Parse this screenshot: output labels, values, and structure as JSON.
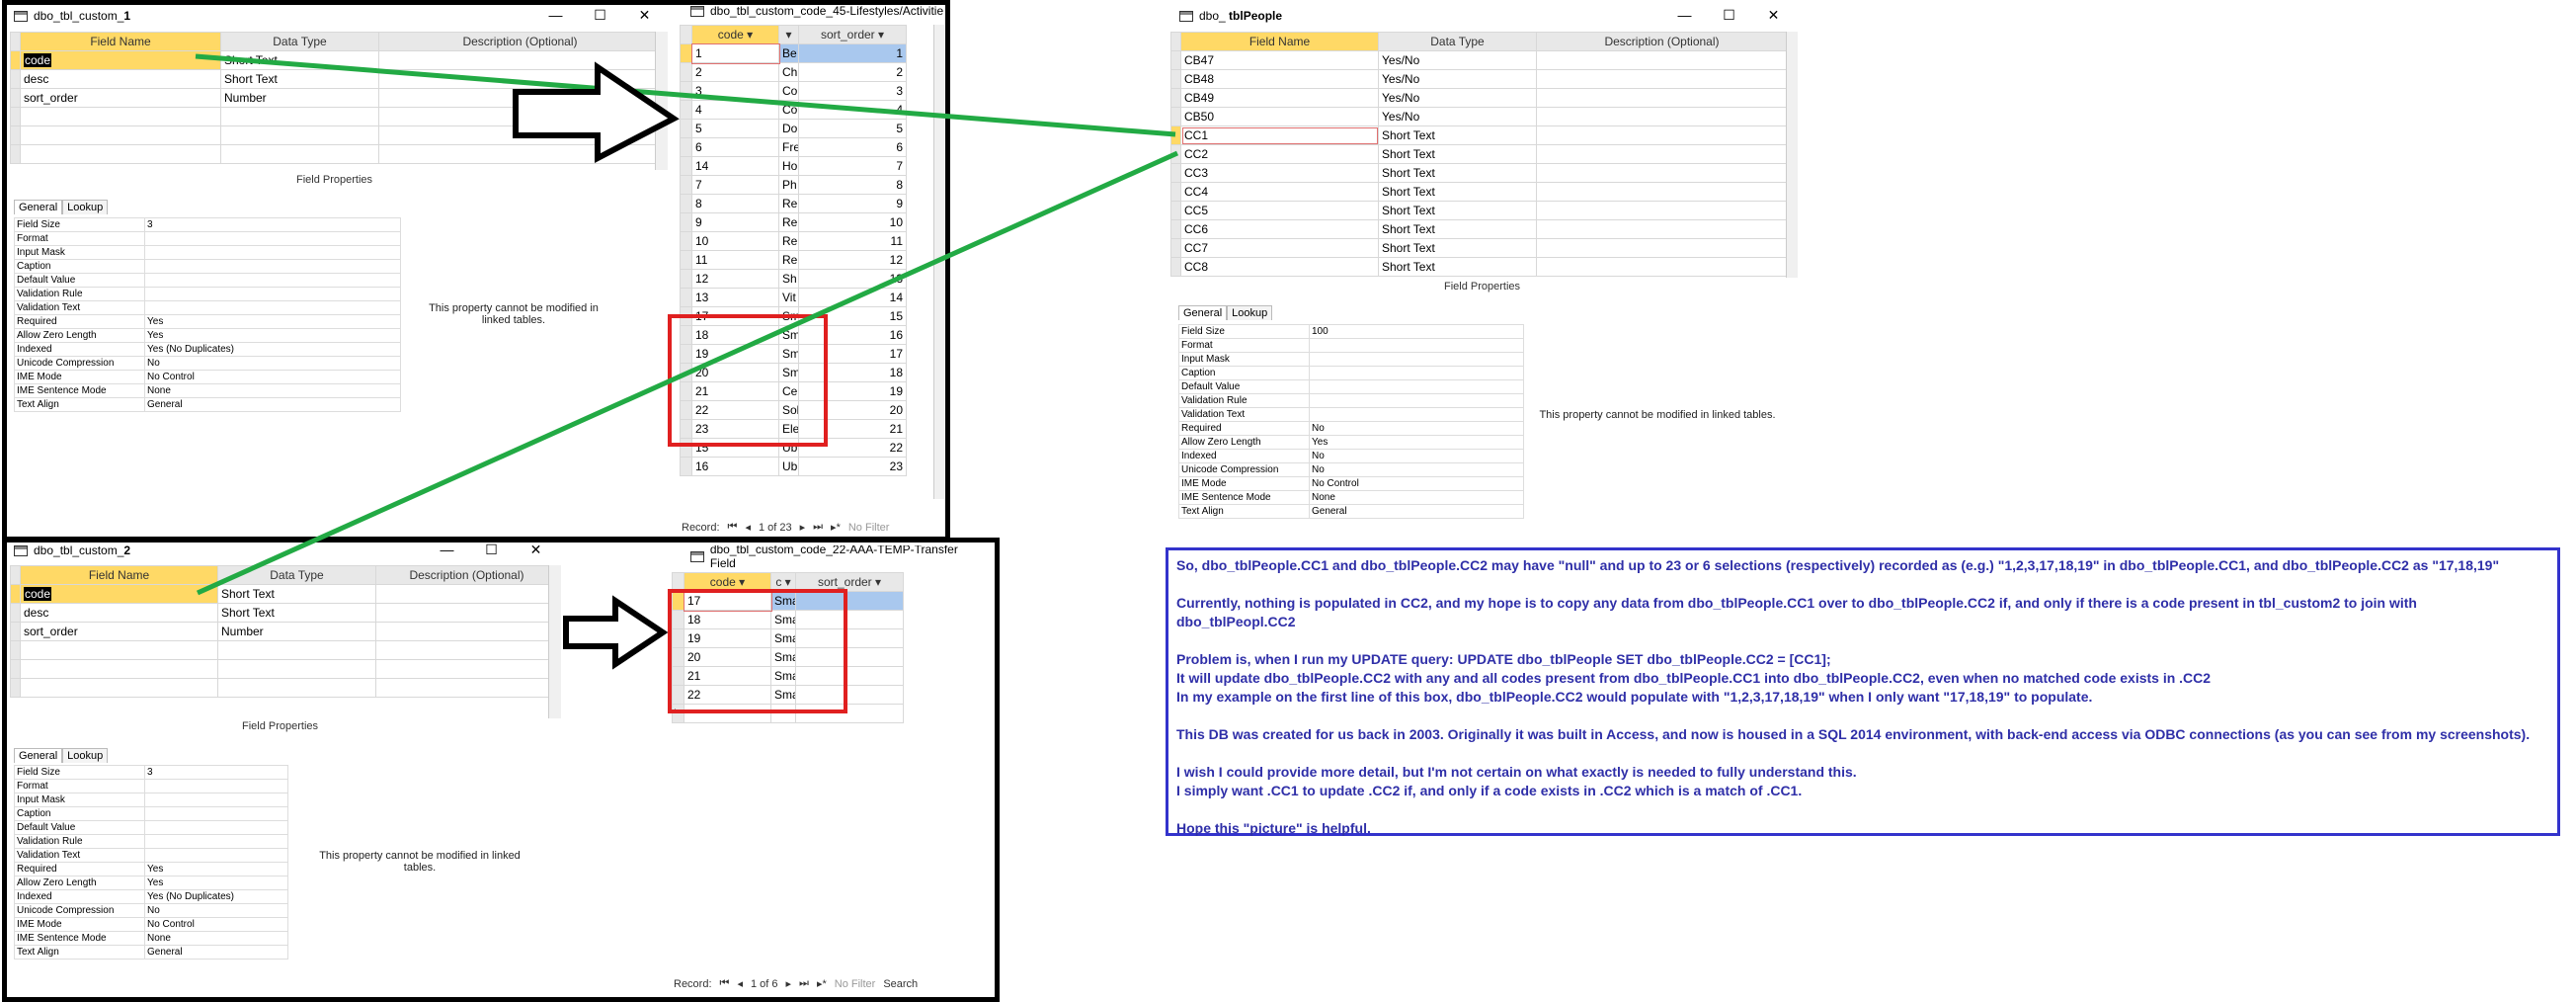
{
  "win1": {
    "title_pre": "dbo_tbl_custom_",
    "title_num": "1",
    "headers": [
      "Field Name",
      "Data Type",
      "Description (Optional)"
    ],
    "rows": [
      {
        "name": "code",
        "type": "Short Text"
      },
      {
        "name": "desc",
        "type": "Short Text"
      },
      {
        "name": "sort_order",
        "type": "Number"
      }
    ],
    "field_properties": "Field Properties",
    "tabs": [
      "General",
      "Lookup"
    ],
    "props": [
      [
        "Field Size",
        "3"
      ],
      [
        "Format",
        ""
      ],
      [
        "Input Mask",
        ""
      ],
      [
        "Caption",
        ""
      ],
      [
        "Default Value",
        ""
      ],
      [
        "Validation Rule",
        ""
      ],
      [
        "Validation Text",
        ""
      ],
      [
        "Required",
        "Yes"
      ],
      [
        "Allow Zero Length",
        "Yes"
      ],
      [
        "Indexed",
        "Yes (No Duplicates)"
      ],
      [
        "Unicode Compression",
        "No"
      ],
      [
        "IME Mode",
        "No Control"
      ],
      [
        "IME Sentence Mode",
        "None"
      ],
      [
        "Text Align",
        "General"
      ]
    ],
    "note": "This property cannot be modified in linked tables."
  },
  "win2": {
    "title_pre": "dbo_tbl_custom_",
    "title_num": "2",
    "headers": [
      "Field Name",
      "Data Type",
      "Description (Optional)"
    ],
    "rows": [
      {
        "name": "code",
        "type": "Short Text"
      },
      {
        "name": "desc",
        "type": "Short Text"
      },
      {
        "name": "sort_order",
        "type": "Number"
      }
    ],
    "field_properties": "Field Properties",
    "tabs": [
      "General",
      "Lookup"
    ],
    "props": [
      [
        "Field Size",
        "3"
      ],
      [
        "Format",
        ""
      ],
      [
        "Input Mask",
        ""
      ],
      [
        "Caption",
        ""
      ],
      [
        "Default Value",
        ""
      ],
      [
        "Validation Rule",
        ""
      ],
      [
        "Validation Text",
        ""
      ],
      [
        "Required",
        "Yes"
      ],
      [
        "Allow Zero Length",
        "Yes"
      ],
      [
        "Indexed",
        "Yes (No Duplicates)"
      ],
      [
        "Unicode Compression",
        "No"
      ],
      [
        "IME Mode",
        "No Control"
      ],
      [
        "IME Sentence Mode",
        "None"
      ],
      [
        "Text Align",
        "General"
      ]
    ],
    "note": "This property cannot be modified in linked tables."
  },
  "ds1": {
    "title": "dbo_tbl_custom_code_45-Lifestyles/Activitie",
    "headers": [
      "code",
      "",
      "sort_order"
    ],
    "rows": [
      [
        "1",
        "Be",
        "1"
      ],
      [
        "2",
        "Ch",
        "2"
      ],
      [
        "3",
        "Co",
        "3"
      ],
      [
        "4",
        "Co",
        "4"
      ],
      [
        "5",
        "Do",
        "5"
      ],
      [
        "6",
        "Fre",
        "6"
      ],
      [
        "14",
        "Ho",
        "7"
      ],
      [
        "7",
        "Ph",
        "8"
      ],
      [
        "8",
        "Re",
        "9"
      ],
      [
        "9",
        "Re",
        "10"
      ],
      [
        "10",
        "Re",
        "11"
      ],
      [
        "11",
        "Re",
        "12"
      ],
      [
        "12",
        "Sh",
        "13"
      ],
      [
        "13",
        "Vit",
        "14"
      ],
      [
        "17",
        "Sm",
        "15"
      ],
      [
        "18",
        "Sm",
        "16"
      ],
      [
        "19",
        "Sm",
        "17"
      ],
      [
        "20",
        "Sm",
        "18"
      ],
      [
        "21",
        "Ce",
        "19"
      ],
      [
        "22",
        "Sol",
        "20"
      ],
      [
        "23",
        "Ele",
        "21"
      ],
      [
        "15",
        "Ub",
        "22"
      ],
      [
        "16",
        "Ub",
        "23"
      ]
    ],
    "record_label": "Record:",
    "record_pos": "1 of 23",
    "no_filter": "No Filter"
  },
  "ds2": {
    "title": "dbo_tbl_custom_code_22-AAA-TEMP-Transfer Field",
    "headers": [
      "code",
      "c",
      "sort_order"
    ],
    "rows": [
      [
        "17",
        "Sma",
        ""
      ],
      [
        "18",
        "Sma",
        ""
      ],
      [
        "19",
        "Sma",
        ""
      ],
      [
        "20",
        "Sma",
        ""
      ],
      [
        "21",
        "Sma",
        ""
      ],
      [
        "22",
        "Sma",
        ""
      ]
    ],
    "record_label": "Record:",
    "record_pos": "1 of 6",
    "no_filter": "No Filter",
    "search": "Search"
  },
  "people": {
    "title_pre": "dbo_",
    "title_main": "tblPeople",
    "headers": [
      "Field Name",
      "Data Type",
      "Description (Optional)"
    ],
    "rows": [
      {
        "name": "CB47",
        "type": "Yes/No"
      },
      {
        "name": "CB48",
        "type": "Yes/No"
      },
      {
        "name": "CB49",
        "type": "Yes/No"
      },
      {
        "name": "CB50",
        "type": "Yes/No"
      },
      {
        "name": "CC1",
        "type": "Short Text"
      },
      {
        "name": "CC2",
        "type": "Short Text"
      },
      {
        "name": "CC3",
        "type": "Short Text"
      },
      {
        "name": "CC4",
        "type": "Short Text"
      },
      {
        "name": "CC5",
        "type": "Short Text"
      },
      {
        "name": "CC6",
        "type": "Short Text"
      },
      {
        "name": "CC7",
        "type": "Short Text"
      },
      {
        "name": "CC8",
        "type": "Short Text"
      }
    ],
    "field_properties": "Field Properties",
    "tabs": [
      "General",
      "Lookup"
    ],
    "props": [
      [
        "Field Size",
        "100"
      ],
      [
        "Format",
        ""
      ],
      [
        "Input Mask",
        ""
      ],
      [
        "Caption",
        ""
      ],
      [
        "Default Value",
        ""
      ],
      [
        "Validation Rule",
        ""
      ],
      [
        "Validation Text",
        ""
      ],
      [
        "Required",
        "No"
      ],
      [
        "Allow Zero Length",
        "Yes"
      ],
      [
        "Indexed",
        "No"
      ],
      [
        "Unicode Compression",
        "No"
      ],
      [
        "IME Mode",
        "No Control"
      ],
      [
        "IME Sentence Mode",
        "None"
      ],
      [
        "Text Align",
        "General"
      ]
    ],
    "note": "This property cannot be modified in linked tables."
  },
  "explanation": [
    "So, dbo_tblPeople.CC1 and dbo_tblPeople.CC2 may have \"null\" and up to 23 or 6 selections (respectively) recorded as (e.g.) \"1,2,3,17,18,19\" in dbo_tblPeople.CC1, and dbo_tblPeople.CC2 as \"17,18,19\"",
    "",
    "Currently, nothing is populated in CC2, and my hope is to copy any data from dbo_tblPeople.CC1 over to dbo_tblPeople.CC2 if, and only if there is a code present in tbl_custom2 to join with",
    "dbo_tblPeopl.CC2",
    "",
    "Problem is, when I run my UPDATE query: UPDATE dbo_tblPeople SET dbo_tblPeople.CC2 = [CC1];",
    "It will update dbo_tblPeople.CC2 with any and all codes present from dbo_tblPeople.CC1 into dbo_tblPeople.CC2, even when no matched code exists in .CC2",
    "In my example on the first line of this box, dbo_tblPeople.CC2 would populate with \"1,2,3,17,18,19\" when I only want \"17,18,19\" to populate.",
    "",
    "This DB was created for us back in 2003. Originally it was built in Access, and now is housed in a SQL 2014 environment, with back-end access via ODBC connections (as you can see from my screenshots).",
    "",
    "I wish I could provide more detail, but I'm not certain on what exactly is needed to fully understand this.",
    "I simply want .CC1 to update .CC2 if, and only if a code exists in .CC2 which is a match of .CC1.",
    "",
    "Hope this \"picture\" is helpful."
  ],
  "colors": {
    "accent": "#ffd966",
    "arrow_green": "#22aa44",
    "red": "#e02020",
    "blue": "#3333cc",
    "text_blue": "#2f2fa8"
  },
  "icons": [
    "table-icon",
    "minimize-icon",
    "maximize-icon",
    "close-icon",
    "arrow-right-icon"
  ]
}
